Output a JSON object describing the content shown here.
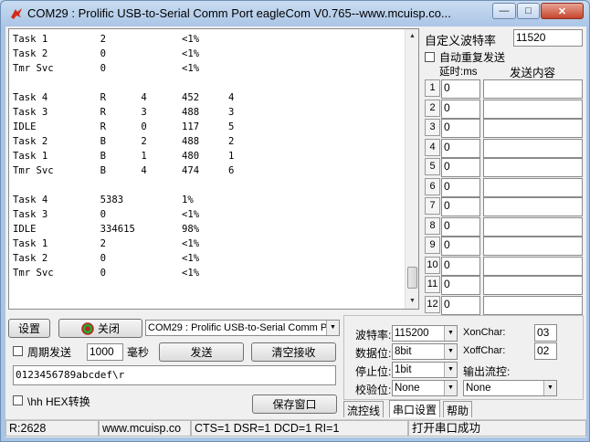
{
  "window": {
    "title": "COM29 : Prolific USB-to-Serial Comm Port  eagleCom V0.765--www.mcuisp.co...",
    "minimize_glyph": "—",
    "maximize_glyph": "□",
    "close_glyph": "✕"
  },
  "receive": {
    "lines": [
      "Task 1         2             <1%",
      "Task 2         0             <1%",
      "Tmr Svc        0             <1%",
      "",
      "Task 4         R      4      452     4",
      "Task 3         R      3      488     3",
      "IDLE           R      0      117     5",
      "Task 2         B      2      488     2",
      "Task 1         B      1      480     1",
      "Tmr Svc        B      4      474     6",
      "",
      "Task 4         5383          1%",
      "Task 3         0             <1%",
      "IDLE           334615        98%",
      "Task 1         2             <1%",
      "Task 2         0             <1%",
      "Tmr Svc        0             <1%"
    ]
  },
  "custom_baud": {
    "label": "自定义波特率",
    "value": "11520"
  },
  "auto_resend": {
    "label": "自动重复发送"
  },
  "multi_send": {
    "col_delay": "延时:ms",
    "col_content": "发送内容",
    "rows": [
      {
        "num": "1",
        "delay": "0",
        "content": ""
      },
      {
        "num": "2",
        "delay": "0",
        "content": ""
      },
      {
        "num": "3",
        "delay": "0",
        "content": ""
      },
      {
        "num": "4",
        "delay": "0",
        "content": ""
      },
      {
        "num": "5",
        "delay": "0",
        "content": ""
      },
      {
        "num": "6",
        "delay": "0",
        "content": ""
      },
      {
        "num": "7",
        "delay": "0",
        "content": ""
      },
      {
        "num": "8",
        "delay": "0",
        "content": ""
      },
      {
        "num": "9",
        "delay": "0",
        "content": ""
      },
      {
        "num": "10",
        "delay": "0",
        "content": ""
      },
      {
        "num": "11",
        "delay": "0",
        "content": ""
      },
      {
        "num": "12",
        "delay": "0",
        "content": ""
      }
    ]
  },
  "controls": {
    "settings_button": "设置",
    "close_button": "关闭",
    "port_select": "COM29 : Prolific USB-to-Serial Comm Por",
    "periodic_label": "周期发送",
    "period_value": "1000",
    "period_unit": "毫秒",
    "send_button": "发送",
    "clear_button": "清空接收",
    "send_input": "0123456789abcdef\\r",
    "hex_label": "\\hh HEX转换",
    "save_button": "保存窗口"
  },
  "serial": {
    "baud_label": "波特率:",
    "baud_value": "115200",
    "data_label": "数据位:",
    "data_value": "8bit",
    "stop_label": "停止位:",
    "stop_value": "1bit",
    "parity_label": "校验位:",
    "parity_value": "None",
    "xon_label": "XonChar:",
    "xon_value": "03",
    "xoff_label": "XoffChar:",
    "xoff_value": "02",
    "flow_label": "输出流控:",
    "flow_value": "None"
  },
  "tabs": [
    "流控线",
    "串口设置",
    "帮助"
  ],
  "status": {
    "rx": "R:2628",
    "site": "www.mcuisp.co",
    "lines": "CTS=1 DSR=1 DCD=1 RI=1",
    "message": "打开串口成功"
  },
  "colors": {
    "title_bg": "#aac5e6",
    "close_btn": "#c5452c",
    "led_green": "#2aa52a"
  }
}
